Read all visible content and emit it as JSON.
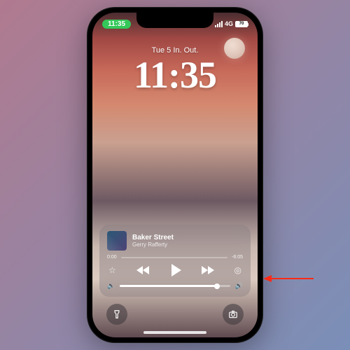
{
  "status": {
    "time_pill": "11:35",
    "network_label": "4G",
    "battery_label": "70"
  },
  "lock_screen": {
    "date": "Tue 5  In. Out.",
    "time": "11:35"
  },
  "player": {
    "title": "Baker Street",
    "artist": "Gerry Rafferty",
    "elapsed": "0:00",
    "remaining": "-6:05",
    "progress_pct": 0,
    "volume_pct": 88
  },
  "icons": {
    "star": "☆",
    "airplay": "◎",
    "vol_low": "🔈",
    "vol_high": "🔊",
    "flashlight": "🔦",
    "camera": "📷"
  },
  "colors": {
    "accent_green": "#34c759",
    "arrow": "#ff2a17"
  }
}
